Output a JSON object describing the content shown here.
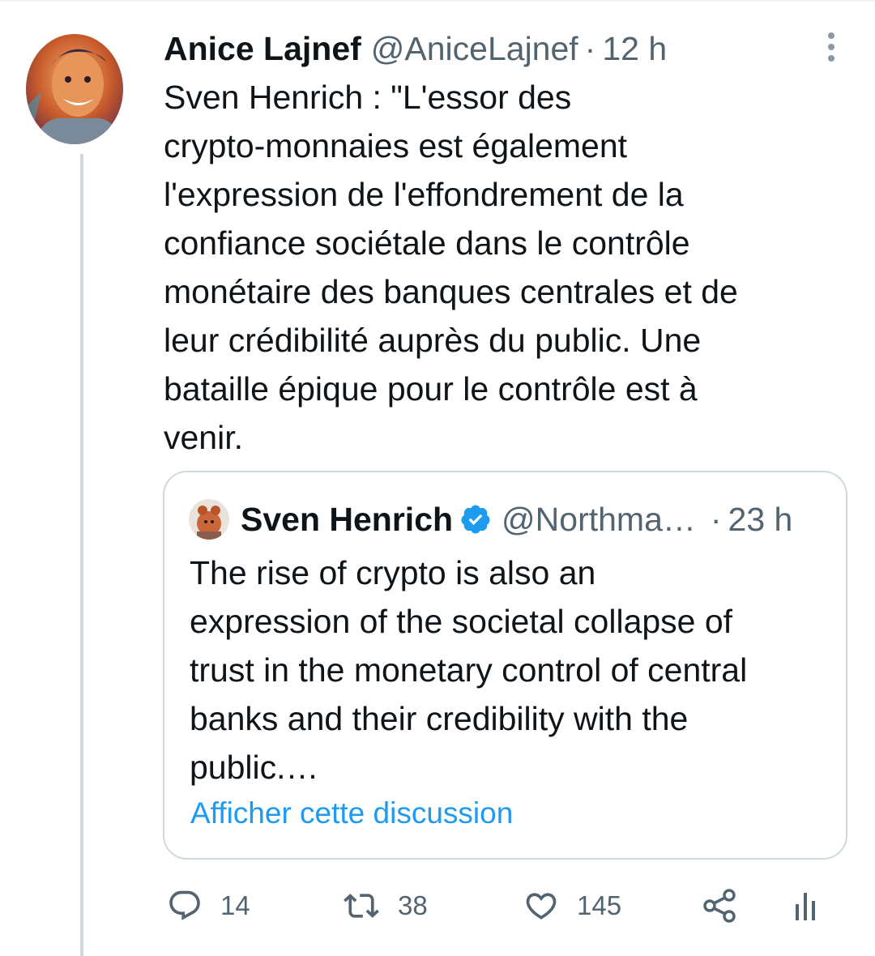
{
  "tweet": {
    "author_name": "Anice Lajnef",
    "author_handle": "@AniceLajnef",
    "separator": "·",
    "time": "12 h",
    "text": "Sven Henrich : \"L'essor des\ncrypto-monnaies est également\nl'expression de l'effondrement de la\nconfiance sociétale dans le contrôle\nmonétaire des banques centrales et de\nleur crédibilité auprès du public. Une\nbataille épique pour le contrôle est à\nvenir."
  },
  "quote": {
    "author_name": "Sven Henrich",
    "author_handle": "@Northma…",
    "separator": "·",
    "time": "23 h",
    "text": "The rise of crypto is also an\nexpression of the societal collapse of\ntrust in the monetary control of central\nbanks and their credibility with the\npublic.…",
    "link_label": "Afficher cette discussion"
  },
  "actions": {
    "replies": "14",
    "retweets": "38",
    "likes": "145"
  },
  "icons": [
    "more-icon",
    "verified-icon",
    "reply-icon",
    "retweet-icon",
    "like-icon",
    "share-icon",
    "analytics-icon"
  ],
  "colors": {
    "text": "#0f1419",
    "secondary": "#536471",
    "link": "#1d9bf0",
    "border": "#cfd9de"
  }
}
